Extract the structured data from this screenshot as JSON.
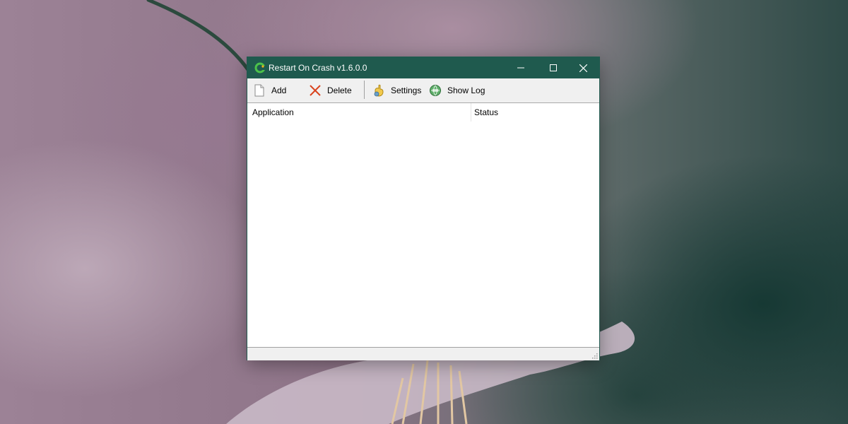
{
  "window": {
    "title": "Restart On Crash v1.6.0.0",
    "controls": {
      "minimize": "minimize-icon",
      "maximize": "maximize-icon",
      "close": "close-icon"
    }
  },
  "toolbar": {
    "add_label": "Add",
    "delete_label": "Delete",
    "settings_label": "Settings",
    "show_log_label": "Show Log",
    "icons": {
      "add": "new-file-icon",
      "delete": "red-x-icon",
      "settings": "settings-hand-icon",
      "show_log": "log-globe-icon"
    }
  },
  "list": {
    "columns": [
      "Application",
      "Status"
    ],
    "rows": []
  },
  "colors": {
    "titlebar": "#1f5a4e",
    "delete_icon": "#d9421c"
  }
}
